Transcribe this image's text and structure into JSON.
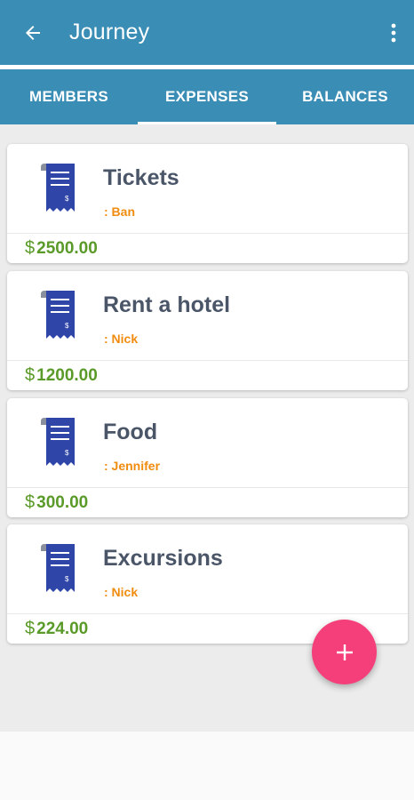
{
  "appbar": {
    "title": "Journey",
    "back_icon": "arrow-left-icon",
    "menu_icon": "more-vertical-icon"
  },
  "tabs": [
    {
      "label": "MEMBERS"
    },
    {
      "label": "EXPENSES",
      "selected": true
    },
    {
      "label": "BALANCES"
    }
  ],
  "expenses": [
    {
      "title": "Tickets",
      "payer": ": Ban",
      "currency": "$",
      "amount": "2500.00",
      "icon": "receipt-icon"
    },
    {
      "title": "Rent a hotel",
      "payer": ": Nick",
      "currency": "$",
      "amount": "1200.00",
      "icon": "receipt-icon"
    },
    {
      "title": "Food",
      "payer": ": Jennifer",
      "currency": "$",
      "amount": "300.00",
      "icon": "receipt-icon"
    },
    {
      "title": "Excursions",
      "payer": ": Nick",
      "currency": "$",
      "amount": "224.00",
      "icon": "receipt-icon"
    }
  ],
  "fab": {
    "icon": "plus-icon",
    "label": "+"
  },
  "colors": {
    "primary": "#3a8db5",
    "accent": "#f43f7a",
    "amount": "#5a9a28",
    "payer": "#f08c10",
    "receipt": "#2f45a8"
  }
}
